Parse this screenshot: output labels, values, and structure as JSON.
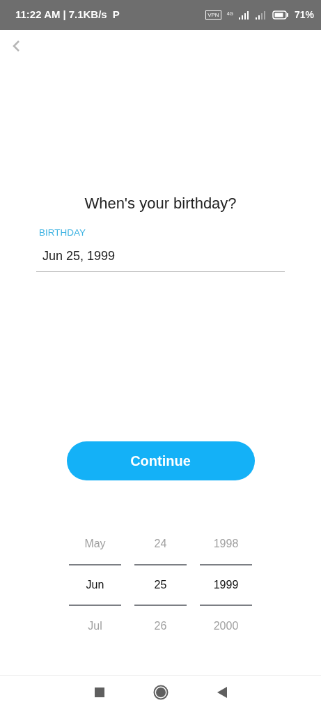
{
  "status_bar": {
    "time": "11:22 AM",
    "separator": "|",
    "speed": "7.1KB/s",
    "notification": "P",
    "vpn": "VPN",
    "network": "4G",
    "battery": "71%"
  },
  "title": "When's your birthday?",
  "birthday_field": {
    "label": "BIRTHDAY",
    "value": "Jun 25, 1999"
  },
  "continue_button": "Continue",
  "picker": [
    {
      "items": [
        {
          "label": "May",
          "selected": false
        },
        {
          "label": "Jun",
          "selected": true
        },
        {
          "label": "Jul",
          "selected": false
        }
      ]
    },
    {
      "items": [
        {
          "label": "24",
          "selected": false
        },
        {
          "label": "25",
          "selected": true
        },
        {
          "label": "26",
          "selected": false
        }
      ]
    },
    {
      "items": [
        {
          "label": "1998",
          "selected": false
        },
        {
          "label": "1999",
          "selected": true
        },
        {
          "label": "2000",
          "selected": false
        }
      ]
    }
  ]
}
